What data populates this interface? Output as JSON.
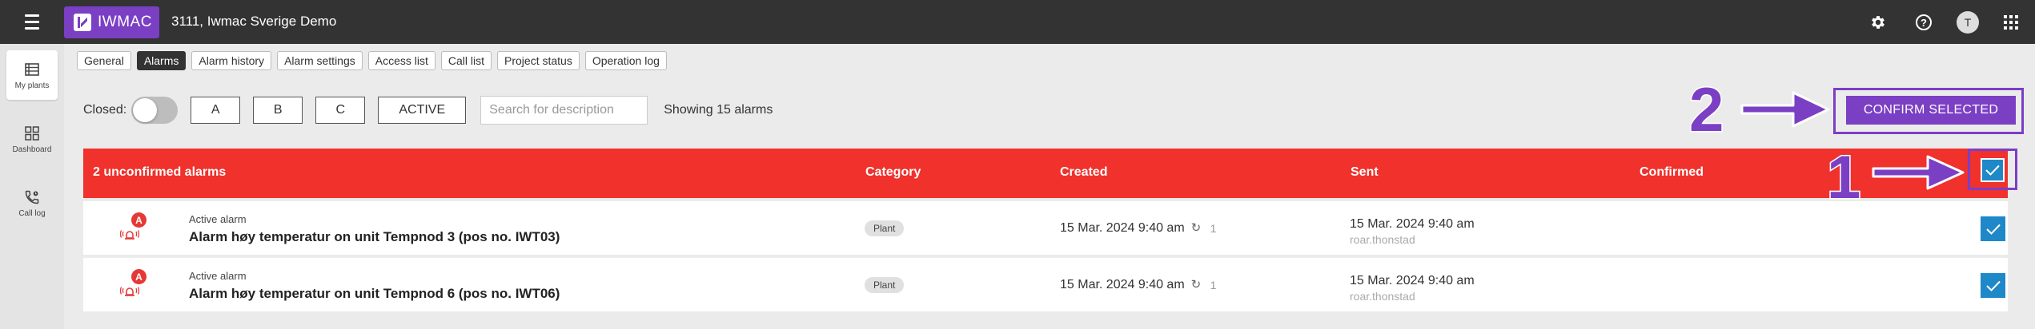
{
  "topbar": {
    "logo_text": "IWMAC",
    "site_title": "3111, Iwmac Sverige Demo",
    "avatar_initial": "T",
    "icons": [
      "menu-icon",
      "gear-icon",
      "help-icon",
      "apps-icon"
    ]
  },
  "sidenav": {
    "items": [
      {
        "label": "My plants",
        "icon": "list-icon"
      },
      {
        "label": "Dashboard",
        "icon": "dashboard-icon"
      },
      {
        "label": "Call log",
        "icon": "phone-icon"
      }
    ]
  },
  "tabs": [
    {
      "label": "General"
    },
    {
      "label": "Alarms"
    },
    {
      "label": "Alarm history"
    },
    {
      "label": "Alarm settings"
    },
    {
      "label": "Access list"
    },
    {
      "label": "Call list"
    },
    {
      "label": "Project status"
    },
    {
      "label": "Operation log"
    }
  ],
  "active_tab": "Alarms",
  "filters": {
    "closed_label": "Closed:",
    "closed_toggle": false,
    "buttons": [
      "A",
      "B",
      "C",
      "ACTIVE"
    ],
    "search_placeholder": "Search for description",
    "showing_text": "Showing 15 alarms"
  },
  "confirm_button": "CONFIRM SELECTED",
  "annotations": {
    "step1": "1",
    "step2": "2",
    "color": "#7b3fc4"
  },
  "table": {
    "header_title": "2 unconfirmed alarms",
    "columns": {
      "category": "Category",
      "created": "Created",
      "sent": "Sent",
      "confirmed": "Confirmed"
    },
    "header_color": "#f0312c",
    "select_all_checked": true,
    "rows": [
      {
        "badge": "A",
        "type": "Active alarm",
        "description": "Alarm høy temperatur on unit Tempnod 3 (pos no. IWT03)",
        "category": "Plant",
        "created": "15 Mar. 2024 9:40 am",
        "repeat_count": "1",
        "sent": "15 Mar. 2024 9:40 am",
        "sent_by": "roar.thonstad",
        "checked": true
      },
      {
        "badge": "A",
        "type": "Active alarm",
        "description": "Alarm høy temperatur on unit Tempnod 6 (pos no. IWT06)",
        "category": "Plant",
        "created": "15 Mar. 2024 9:40 am",
        "repeat_count": "1",
        "sent": "15 Mar. 2024 9:40 am",
        "sent_by": "roar.thonstad",
        "checked": true
      }
    ]
  },
  "colors": {
    "accent": "#7b3fc4",
    "checkbox": "#1e88c8",
    "topbar": "#333333"
  }
}
